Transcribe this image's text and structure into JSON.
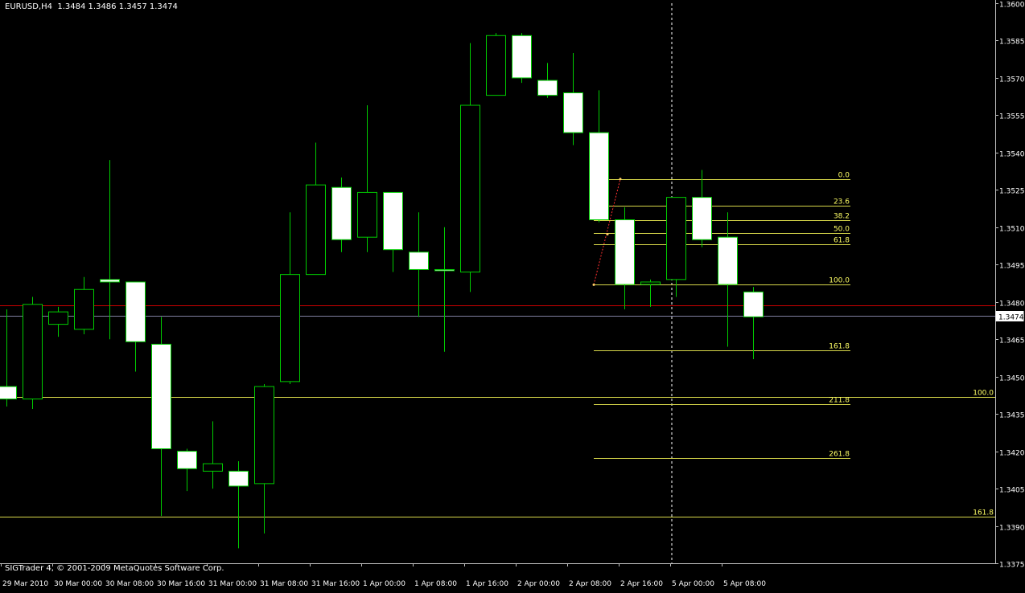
{
  "header": {
    "symbol": "EURUSD,H4",
    "ohlc": "1.3484 1.3486 1.3457 1.3474"
  },
  "footer": {
    "copyright": "SIGTrader 4, © 2001-2009 MetaQuotes Software Corp."
  },
  "colors": {
    "background": "#000000",
    "candle_border": "#00cc00",
    "bull_fill": "#000000",
    "bear_fill": "#ffffff",
    "fib_line": "#d8d84a",
    "fib_text": "#ffff66",
    "price_line": "#cc0000",
    "bid_line": "#8080a0",
    "axis_text": "#ffffff",
    "axis_line": "#c0c0c0"
  },
  "chart_data": {
    "type": "candlestick",
    "y_axis": {
      "min": 1.3375,
      "max": 1.36,
      "ticks": [
        "1.3600",
        "1.3585",
        "1.3570",
        "1.3555",
        "1.3540",
        "1.3525",
        "1.3510",
        "1.3495",
        "1.3480",
        "1.3465",
        "1.3450",
        "1.3435",
        "1.3420",
        "1.3405",
        "1.3390",
        "1.3375"
      ],
      "current_price_label": "1.3474"
    },
    "x_axis": {
      "labels": [
        "29 Mar 2010",
        "30 Mar 00:00",
        "30 Mar 08:00",
        "30 Mar 16:00",
        "31 Mar 00:00",
        "31 Mar 08:00",
        "31 Mar 16:00",
        "1 Apr 00:00",
        "1 Apr 08:00",
        "1 Apr 16:00",
        "2 Apr 00:00",
        "2 Apr 08:00",
        "2 Apr 16:00",
        "5 Apr 00:00",
        "5 Apr 08:00"
      ]
    },
    "candles": [
      {
        "o": 1.3446,
        "h": 1.3477,
        "l": 1.3438,
        "c": 1.3441
      },
      {
        "o": 1.3441,
        "h": 1.3482,
        "l": 1.3437,
        "c": 1.3479
      },
      {
        "o": 1.3471,
        "h": 1.3478,
        "l": 1.3466,
        "c": 1.3476
      },
      {
        "o": 1.3469,
        "h": 1.349,
        "l": 1.3467,
        "c": 1.3485
      },
      {
        "o": 1.3489,
        "h": 1.3537,
        "l": 1.3465,
        "c": 1.3488
      },
      {
        "o": 1.3488,
        "h": 1.3488,
        "l": 1.3452,
        "c": 1.3464
      },
      {
        "o": 1.3463,
        "h": 1.3474,
        "l": 1.3394,
        "c": 1.3421
      },
      {
        "o": 1.342,
        "h": 1.3421,
        "l": 1.3404,
        "c": 1.3413
      },
      {
        "o": 1.3412,
        "h": 1.3432,
        "l": 1.3405,
        "c": 1.3415
      },
      {
        "o": 1.3412,
        "h": 1.3416,
        "l": 1.3381,
        "c": 1.3406
      },
      {
        "o": 1.3407,
        "h": 1.3447,
        "l": 1.3387,
        "c": 1.3446
      },
      {
        "o": 1.3448,
        "h": 1.3516,
        "l": 1.3447,
        "c": 1.3491
      },
      {
        "o": 1.3491,
        "h": 1.3544,
        "l": 1.3491,
        "c": 1.3527
      },
      {
        "o": 1.3526,
        "h": 1.353,
        "l": 1.35,
        "c": 1.3505
      },
      {
        "o": 1.3506,
        "h": 1.3559,
        "l": 1.35,
        "c": 1.3524
      },
      {
        "o": 1.3524,
        "h": 1.3524,
        "l": 1.3492,
        "c": 1.3501
      },
      {
        "o": 1.35,
        "h": 1.3516,
        "l": 1.3474,
        "c": 1.3493
      },
      {
        "o": 1.3493,
        "h": 1.351,
        "l": 1.346,
        "c": 1.3493
      },
      {
        "o": 1.3492,
        "h": 1.3584,
        "l": 1.3484,
        "c": 1.3559
      },
      {
        "o": 1.3563,
        "h": 1.3588,
        "l": 1.3563,
        "c": 1.3587
      },
      {
        "o": 1.3587,
        "h": 1.3588,
        "l": 1.3568,
        "c": 1.357
      },
      {
        "o": 1.3569,
        "h": 1.3576,
        "l": 1.3562,
        "c": 1.3563
      },
      {
        "o": 1.3564,
        "h": 1.358,
        "l": 1.3543,
        "c": 1.3548
      },
      {
        "o": 1.3548,
        "h": 1.3565,
        "l": 1.3512,
        "c": 1.3513
      },
      {
        "o": 1.3513,
        "h": 1.3518,
        "l": 1.3477,
        "c": 1.3487
      },
      {
        "o": 1.3487,
        "h": 1.3489,
        "l": 1.3478,
        "c": 1.3488
      },
      {
        "o": 1.3489,
        "h": 1.3522,
        "l": 1.3482,
        "c": 1.3522
      },
      {
        "o": 1.3522,
        "h": 1.3533,
        "l": 1.3502,
        "c": 1.3505
      },
      {
        "o": 1.3506,
        "h": 1.3516,
        "l": 1.3462,
        "c": 1.3487
      },
      {
        "o": 1.3484,
        "h": 1.3486,
        "l": 1.3457,
        "c": 1.3474
      }
    ],
    "horizontal_lines": [
      {
        "price": 1.34787,
        "kind": "red"
      },
      {
        "price": 1.34745,
        "kind": "bid"
      },
      {
        "price": 1.34418,
        "kind": "fib",
        "label": "100.0"
      },
      {
        "price": 1.33938,
        "kind": "fib",
        "label": "161.8"
      }
    ],
    "fibonacci": {
      "levels": [
        {
          "label": "0.0",
          "price": 1.35294
        },
        {
          "label": "23.6",
          "price": 1.35185
        },
        {
          "label": "38.2",
          "price": 1.35127
        },
        {
          "label": "50.0",
          "price": 1.35076
        },
        {
          "label": "61.8",
          "price": 1.35033
        },
        {
          "label": "100.0",
          "price": 1.34869
        },
        {
          "label": "161.8",
          "price": 1.34605
        },
        {
          "label": "211.8",
          "price": 1.34389
        },
        {
          "label": "261.8",
          "price": 1.34173
        }
      ]
    }
  }
}
